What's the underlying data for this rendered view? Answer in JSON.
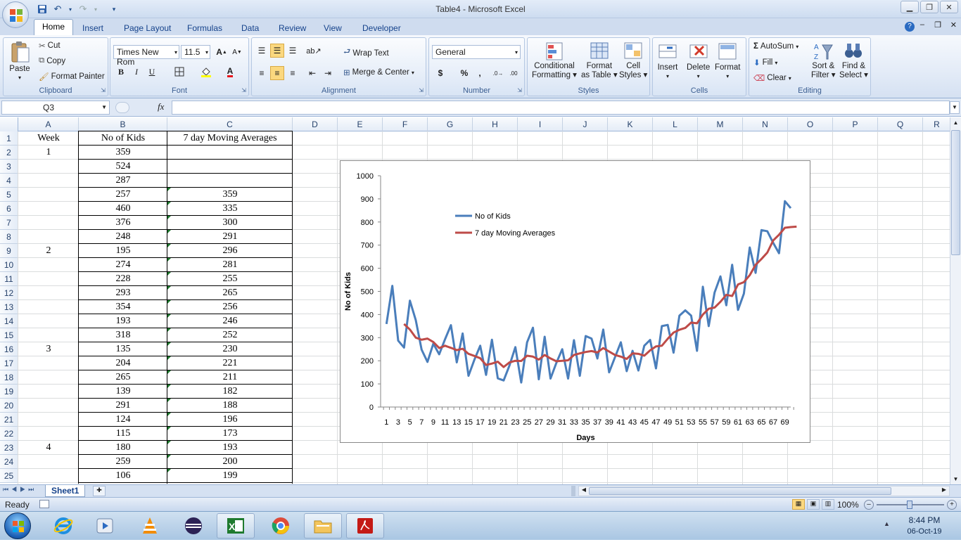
{
  "window": {
    "title": "Table4 - Microsoft Excel"
  },
  "tabs": [
    "Home",
    "Insert",
    "Page Layout",
    "Formulas",
    "Data",
    "Review",
    "View",
    "Developer"
  ],
  "ribbon": {
    "clipboard": {
      "paste": "Paste",
      "cut": "Cut",
      "copy": "Copy",
      "format_painter": "Format Painter",
      "label": "Clipboard"
    },
    "font": {
      "name": "Times New Rom",
      "size": "11.5",
      "label": "Font",
      "bold": "B",
      "italic": "I",
      "underline": "U"
    },
    "alignment": {
      "wrap": "Wrap Text",
      "merge": "Merge & Center",
      "label": "Alignment"
    },
    "number": {
      "format": "General",
      "label": "Number",
      "currency": "$",
      "percent": "%",
      "comma": ","
    },
    "styles": {
      "cond1": "Conditional",
      "cond2": "Formatting",
      "fmt1": "Format",
      "fmt2": "as Table",
      "cell1": "Cell",
      "cell2": "Styles",
      "label": "Styles"
    },
    "cells": {
      "insert": "Insert",
      "delete": "Delete",
      "format": "Format",
      "label": "Cells"
    },
    "editing": {
      "autosum": "AutoSum",
      "fill": "Fill",
      "clear": "Clear",
      "sort1": "Sort &",
      "sort2": "Filter",
      "find1": "Find &",
      "find2": "Select",
      "label": "Editing"
    }
  },
  "formula_bar": {
    "name_box": "Q3",
    "fx": "fx",
    "value": ""
  },
  "columns": [
    "A",
    "B",
    "C",
    "D",
    "E",
    "F",
    "G",
    "H",
    "I",
    "J",
    "K",
    "L",
    "M",
    "N",
    "O",
    "P",
    "Q",
    "R"
  ],
  "rows": [
    "1",
    "2",
    "3",
    "4",
    "5",
    "6",
    "7",
    "8",
    "9",
    "10",
    "11",
    "12",
    "13",
    "14",
    "15",
    "16",
    "17",
    "18",
    "19",
    "20",
    "21",
    "22",
    "23",
    "24",
    "25"
  ],
  "table": {
    "headers": [
      "Week",
      "No of Kids",
      "7 day Moving Averages"
    ],
    "week": [
      "1",
      "",
      "",
      "",
      "",
      "",
      "",
      "2",
      "",
      "",
      "",
      "",
      "",
      "",
      "3",
      "",
      "",
      "",
      "",
      "",
      "",
      "4",
      "",
      ""
    ],
    "kids": [
      "359",
      "524",
      "287",
      "257",
      "460",
      "376",
      "248",
      "195",
      "274",
      "228",
      "293",
      "354",
      "193",
      "318",
      "135",
      "204",
      "265",
      "139",
      "291",
      "124",
      "115",
      "180",
      "259",
      "106"
    ],
    "avg": [
      "",
      "",
      "",
      "359",
      "335",
      "300",
      "291",
      "296",
      "281",
      "255",
      "265",
      "256",
      "246",
      "252",
      "230",
      "221",
      "211",
      "182",
      "188",
      "196",
      "173",
      "193",
      "200",
      "199"
    ]
  },
  "chart_data": {
    "type": "line",
    "xlabel": "Days",
    "ylabel": "No of Kids",
    "ylim": [
      0,
      1000
    ],
    "yticks": [
      "0",
      "100",
      "200",
      "300",
      "400",
      "500",
      "600",
      "700",
      "800",
      "900",
      "1000"
    ],
    "xticks": [
      "1",
      "3",
      "5",
      "7",
      "9",
      "11",
      "13",
      "15",
      "17",
      "19",
      "21",
      "23",
      "25",
      "27",
      "29",
      "31",
      "33",
      "35",
      "37",
      "39",
      "41",
      "43",
      "45",
      "47",
      "49",
      "51",
      "53",
      "55",
      "57",
      "59",
      "61",
      "63",
      "65",
      "67",
      "69"
    ],
    "legend_position": "top-left",
    "series": [
      {
        "name": "No of Kids",
        "color": "#4a7ebb",
        "start_day": 1,
        "values": [
          359,
          524,
          287,
          257,
          460,
          376,
          248,
          195,
          274,
          228,
          293,
          354,
          193,
          318,
          135,
          204,
          265,
          139,
          291,
          124,
          115,
          180,
          259,
          106,
          280,
          343,
          120,
          304,
          123,
          191,
          250,
          123,
          289,
          135,
          307,
          296,
          210,
          335,
          150,
          215,
          280,
          155,
          243,
          158,
          265,
          290,
          167,
          350,
          355,
          235,
          395,
          418,
          395,
          243,
          520,
          350,
          495,
          565,
          440,
          615,
          420,
          490,
          690,
          580,
          765,
          760,
          710,
          665,
          890,
          860
        ]
      },
      {
        "name": "7 day Moving Averages",
        "color": "#be4b48",
        "start_day": 4,
        "values": [
          359,
          335,
          300,
          291,
          296,
          281,
          255,
          265,
          256,
          246,
          252,
          230,
          221,
          211,
          182,
          188,
          196,
          173,
          193,
          200,
          199,
          222,
          218,
          205,
          225,
          210,
          198,
          200,
          202,
          225,
          232,
          238,
          242,
          236,
          255,
          240,
          225,
          218,
          208,
          232,
          230,
          222,
          245,
          262,
          265,
          295,
          322,
          334,
          342,
          365,
          362,
          400,
          425,
          430,
          455,
          485,
          480,
          530,
          540,
          570,
          615,
          640,
          668,
          720,
          745,
          775,
          778,
          780
        ]
      }
    ]
  },
  "sheet_tabs": [
    "Sheet1"
  ],
  "status": {
    "ready": "Ready",
    "zoom": "100%"
  },
  "clock": {
    "time": "8:44 PM",
    "date": "06-Oct-19"
  },
  "colors": {
    "ribbon_bg": "#dfe8f5",
    "accent": "#15428b",
    "series1": "#4a7ebb",
    "series2": "#be4b48"
  }
}
